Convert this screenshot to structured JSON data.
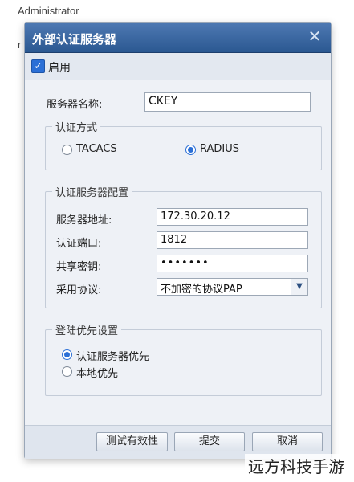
{
  "background": {
    "line1": "Administrator",
    "line2": "r"
  },
  "dialog": {
    "title": "外部认证服务器",
    "close_symbol": "✕",
    "enable_label": "启用",
    "enable_checked": true,
    "server_name_label": "服务器名称:",
    "server_name_value": "CKEY",
    "auth_method": {
      "legend": "认证方式",
      "options": [
        "TACACS",
        "RADIUS"
      ],
      "selected": "RADIUS"
    },
    "server_config": {
      "legend": "认证服务器配置",
      "address_label": "服务器地址:",
      "address_value": "172.30.20.12",
      "port_label": "认证端口:",
      "port_value": "1812",
      "secret_label": "共享密钥:",
      "secret_value": "•••••••",
      "protocol_label": "采用协议:",
      "protocol_value": "不加密的协议PAP"
    },
    "login_priority": {
      "legend": "登陆优先设置",
      "options": [
        "认证服务器优先",
        "本地优先"
      ],
      "selected": "认证服务器优先"
    },
    "buttons": {
      "test": "测试有效性",
      "submit": "提交",
      "cancel": "取消"
    }
  },
  "watermark": "远方科技手游",
  "colors": {
    "title_bar": "#2b5891",
    "accent": "#2b6fd6",
    "dialog_bg": "#eef1f6"
  }
}
